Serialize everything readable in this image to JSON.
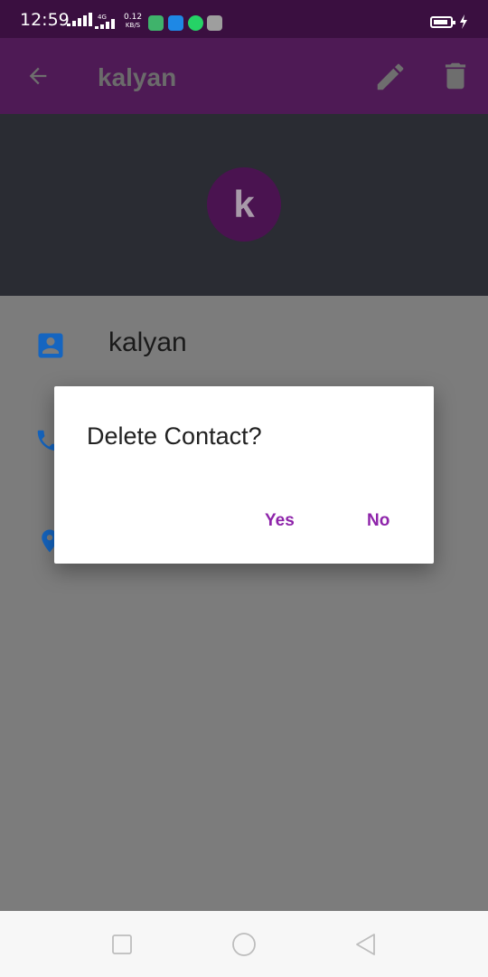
{
  "status_bar": {
    "time": "12:59",
    "network_label": "4G",
    "speed_value": "0.12",
    "speed_unit": "KB/S",
    "app_icons": [
      "maps-icon",
      "location-icon",
      "whatsapp-icon",
      "drive-icon"
    ]
  },
  "app_bar": {
    "title": "kalyan",
    "back_icon": "arrow-back-icon",
    "edit_icon": "pencil-icon",
    "delete_icon": "trash-icon"
  },
  "contact": {
    "avatar_letter": "k",
    "name": "kalyan"
  },
  "dialog": {
    "title": "Delete Contact?",
    "yes_label": "Yes",
    "no_label": "No"
  },
  "nav_bar": {
    "recents_icon": "square-icon",
    "home_icon": "circle-icon",
    "back_icon": "triangle-back-icon"
  },
  "colors": {
    "accent": "#8e24aa",
    "app_bar": "#4e1a55",
    "icon_blue": "#1565c0"
  }
}
